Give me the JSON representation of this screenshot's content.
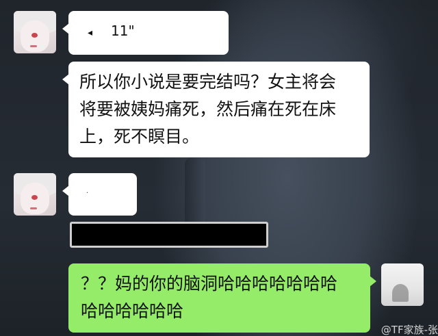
{
  "messages": [
    {
      "side": "left",
      "type": "voice",
      "dot": "◂",
      "duration": "11\""
    },
    {
      "side": "left",
      "type": "text",
      "lines": [
        "所以你小说是要完结吗？女主将会",
        "将要被姨妈痛死，然后痛在死在床",
        "上，死不瞑目。"
      ]
    },
    {
      "side": "left",
      "type": "text",
      "text": "·"
    },
    {
      "side": "left",
      "type": "redacted"
    },
    {
      "side": "right",
      "type": "text",
      "lines": [
        "？？妈的你的脑洞哈哈哈哈哈哈哈",
        "哈哈哈哈哈哈"
      ]
    }
  ],
  "watermark": "@TF家族-张",
  "colors": {
    "bubble_incoming": "#ffffff",
    "bubble_outgoing": "#95ec69",
    "redact": "#000000"
  }
}
